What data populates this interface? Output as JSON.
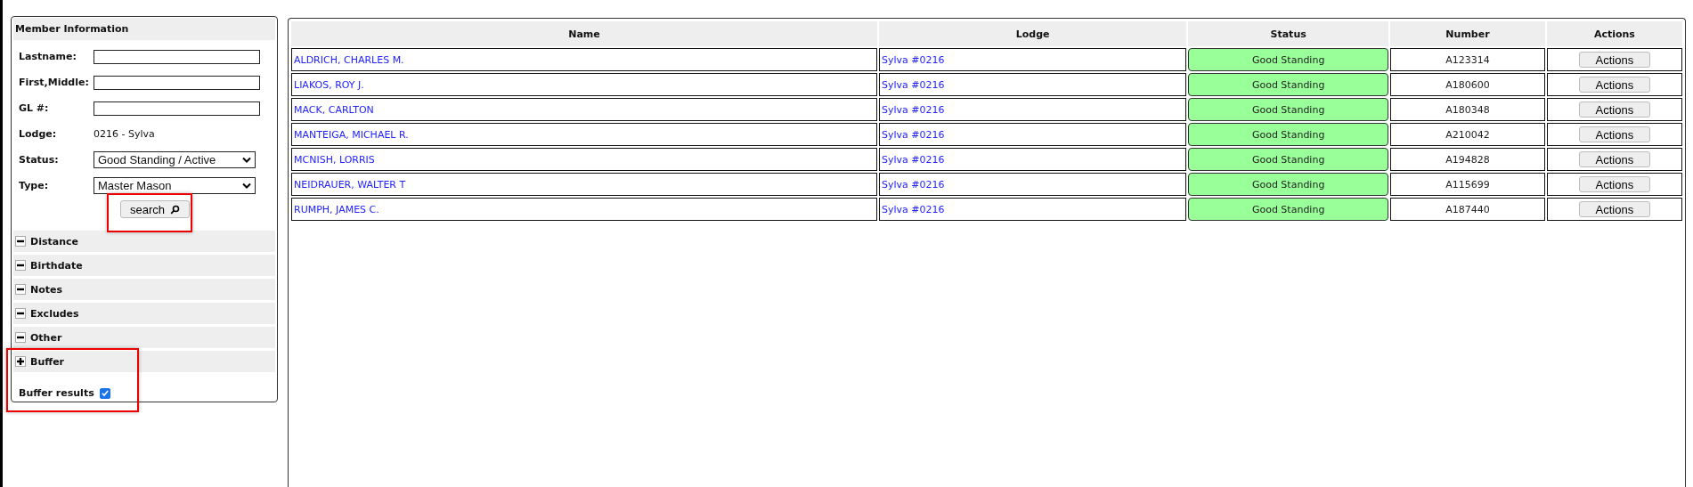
{
  "member_panel": {
    "title": "Member Information",
    "fields": [
      {
        "kind": "input",
        "label": "Lastname:"
      },
      {
        "kind": "input",
        "label": "First,Middle:"
      },
      {
        "kind": "input",
        "label": "GL #:"
      },
      {
        "kind": "text",
        "label": "Lodge:",
        "value": "0216 - Sylva"
      },
      {
        "kind": "select",
        "label": "Status:",
        "value": "Good Standing / Active"
      },
      {
        "kind": "select",
        "label": "Type:",
        "value": "Master Mason"
      }
    ],
    "search_button": "search",
    "sections": [
      {
        "label": "Distance",
        "expanded": false
      },
      {
        "label": "Birthdate",
        "expanded": false
      },
      {
        "label": "Notes",
        "expanded": false
      },
      {
        "label": "Excludes",
        "expanded": false
      },
      {
        "label": "Other",
        "expanded": false
      },
      {
        "label": "Buffer",
        "expanded": true
      }
    ],
    "buffer_results": {
      "label": "Buffer results",
      "checked": true
    }
  },
  "table": {
    "columns": [
      "Name",
      "Lodge",
      "Status",
      "Number",
      "Actions"
    ],
    "rows": [
      {
        "name": "ALDRICH, CHARLES M.",
        "lodge": "Sylva #0216",
        "status": "Good Standing",
        "number": "A123314",
        "action": "Actions"
      },
      {
        "name": "LIAKOS, ROY J.",
        "lodge": "Sylva #0216",
        "status": "Good Standing",
        "number": "A180600",
        "action": "Actions"
      },
      {
        "name": "MACK, CARLTON",
        "lodge": "Sylva #0216",
        "status": "Good Standing",
        "number": "A180348",
        "action": "Actions"
      },
      {
        "name": "MANTEIGA, MICHAEL R.",
        "lodge": "Sylva #0216",
        "status": "Good Standing",
        "number": "A210042",
        "action": "Actions"
      },
      {
        "name": "MCNISH, LORRIS",
        "lodge": "Sylva #0216",
        "status": "Good Standing",
        "number": "A194828",
        "action": "Actions"
      },
      {
        "name": "NEIDRAUER, WALTER T",
        "lodge": "Sylva #0216",
        "status": "Good Standing",
        "number": "A115699",
        "action": "Actions"
      },
      {
        "name": "RUMPH, JAMES C.",
        "lodge": "Sylva #0216",
        "status": "Good Standing",
        "number": "A187440",
        "action": "Actions"
      }
    ]
  }
}
